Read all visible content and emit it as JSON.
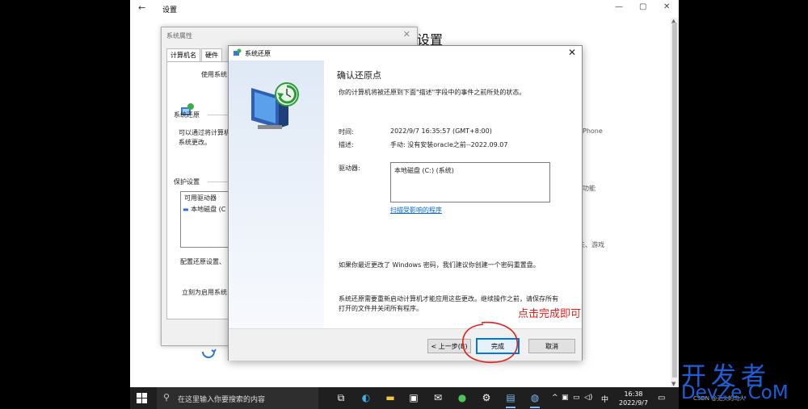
{
  "settings": {
    "back_glyph": "←",
    "title": "设置",
    "minimize": "—",
    "maximize": "▢",
    "close": "✕",
    "heading": "设置",
    "frag_iphone": "Phone",
    "frag_func": "功能",
    "frag_game": "夫、游戏"
  },
  "sysprop": {
    "title": "系统属性",
    "close": "✕",
    "tabs": [
      "计算机名",
      "硬件"
    ],
    "use_system": "使用系统",
    "restore_group": "系统还原",
    "restore_desc_1": "可以通过将计算机",
    "restore_desc_2": "系统更改。",
    "protect_group": "保护设置",
    "drives_header": "可用驱动器",
    "drive_item": "本地磁盘 (C",
    "config_text": "配置还原设置、",
    "enable_text": "立刻为启用系统"
  },
  "wizard": {
    "title": "系统还原",
    "close": "✕",
    "heading": "确认还原点",
    "intro": "你的计算机将被还原到下面\"描述\"字段中的事件之前所处的状态。",
    "time_label": "时间:",
    "time_value": "2022/9/7 16:35:57 (GMT+8:00)",
    "desc_label": "描述:",
    "desc_value": "手动: 没有安装oracle之前--2022.09.07",
    "drive_label": "驱动器:",
    "drive_value": "本地磁盘 (C:) (系统)",
    "scan_link": "扫描受影响的程序",
    "password_note": "如果你最近更改了 Windows 密码，我们建议你创建一个密码重置盘。",
    "restart_note_1": "系统还原需要重新启动计算机才能应用这些更改。继续操作之前，请保存所有",
    "restart_note_2": "打开的文件并关闭所有程序。",
    "back_button": "< 上一步(B)",
    "finish_button": "完成",
    "cancel_button": "取消"
  },
  "annotation": {
    "note": "点击完成即可",
    "color": "#e0201a"
  },
  "taskbar": {
    "search_placeholder": "在这里输入你要搜索的内容",
    "tray_caret": "^",
    "tray_ime": "中",
    "time": "16:38",
    "date": "2022/9/7"
  },
  "watermark": {
    "cn": "开发者",
    "en": "DevZe.CoM",
    "sub": "CSDN @无头的鸟人"
  },
  "colors": {
    "accent": "#0078d7",
    "link": "#0066cc",
    "watermark": "#1e5fd8"
  }
}
